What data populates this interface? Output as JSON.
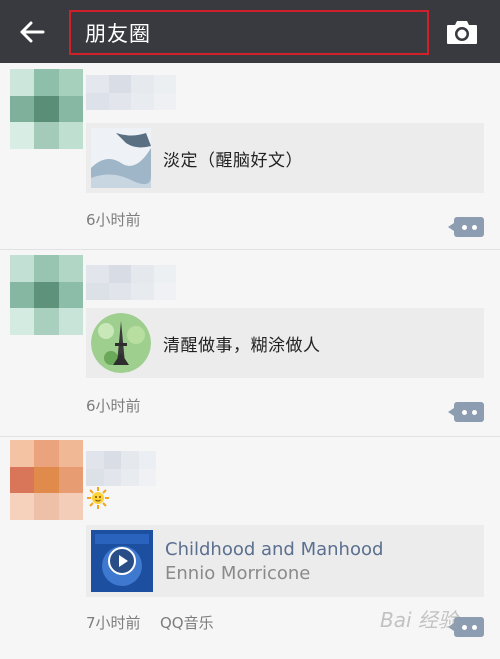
{
  "header": {
    "title": "朋友圈",
    "back_icon": "arrow-left-icon",
    "camera_icon": "camera-icon"
  },
  "posts": [
    {
      "share_title": "淡定（醒脑好文）",
      "time": "6小时前"
    },
    {
      "share_title": "清醒做事，糊涂做人",
      "time": "6小时前"
    },
    {
      "emoji": "sun-emoji",
      "music_title": "Childhood and Manhood",
      "music_artist": "Ennio Morricone",
      "time": "7小时前",
      "source": "QQ音乐"
    }
  ],
  "watermark": "Bai 经验",
  "colors": {
    "topbar": "#393a3f",
    "highlight_border": "#d0212a",
    "link_blue": "#5b6f8f"
  }
}
